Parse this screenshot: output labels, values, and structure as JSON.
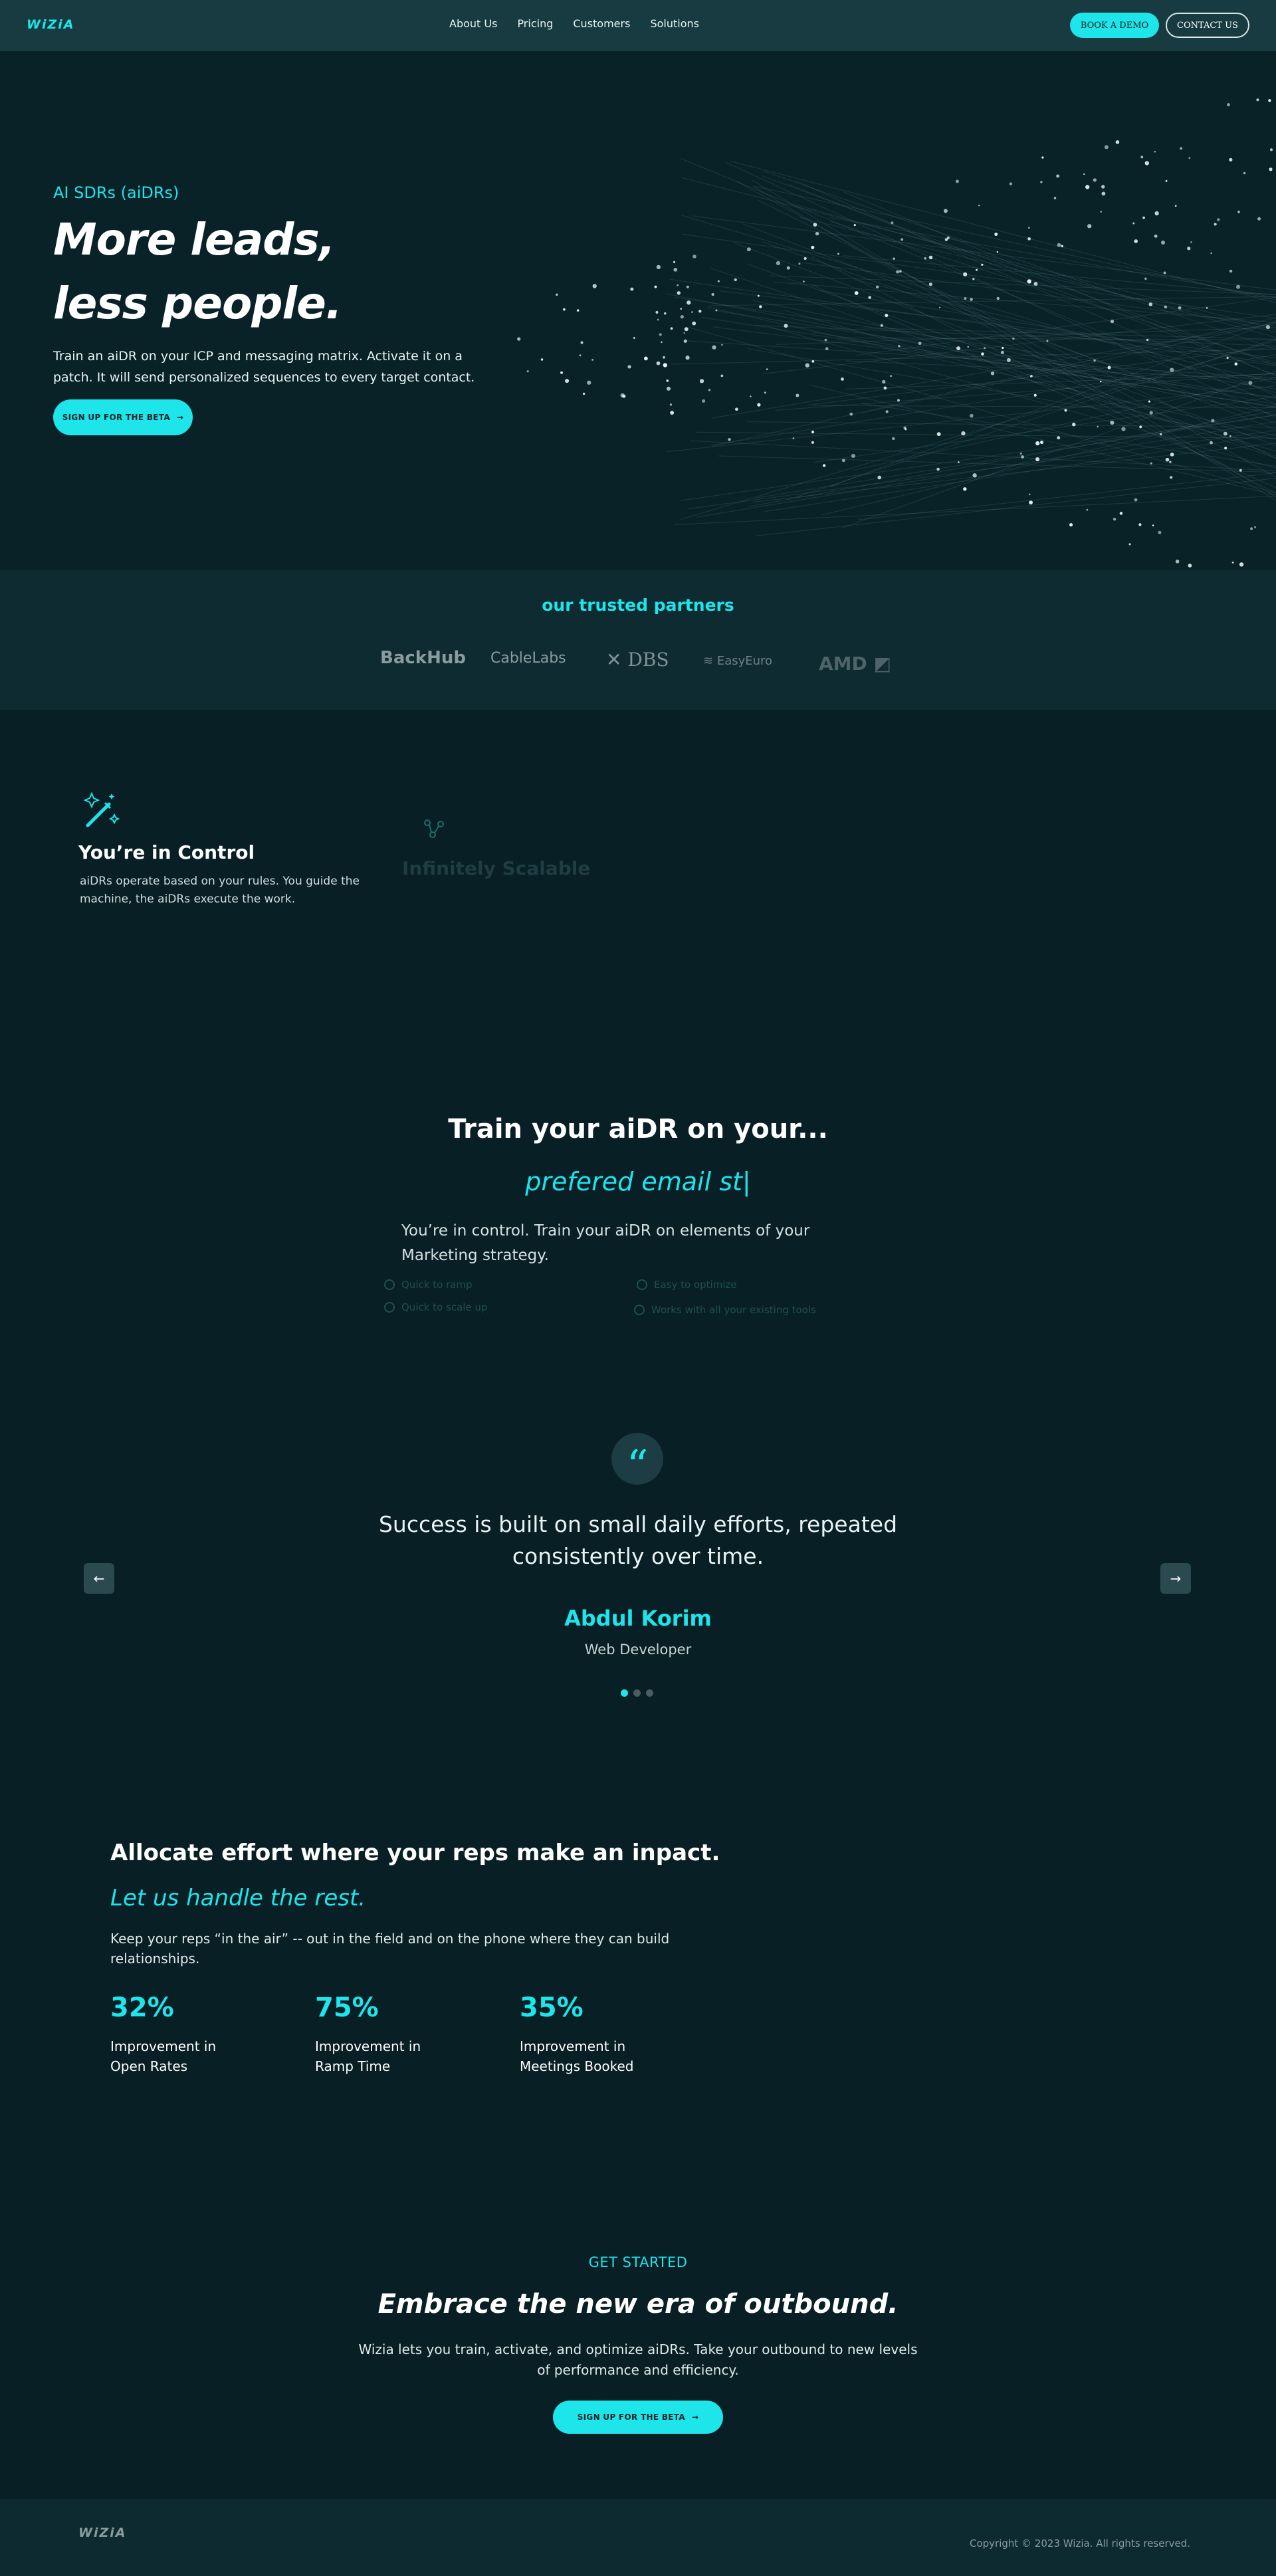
{
  "nav": {
    "logo": "WiZiA",
    "links": [
      "About Us",
      "Pricing",
      "Customers",
      "Solutions"
    ],
    "book_demo": "BOOK A DEMO",
    "contact": "CONTACT US"
  },
  "hero": {
    "eyebrow": "AI SDRs (aiDRs)",
    "title_line1": "More leads,",
    "title_line2": "less people.",
    "description": "Train an aiDR on your ICP and messaging matrix. Activate it on a patch. It will send personalized sequences to every target contact.",
    "cta": "SIGN UP FOR THE BETA"
  },
  "partners": {
    "title": "our trusted partners",
    "logos": [
      "BackHub",
      "CableLabs",
      "DBS",
      "EasyEuro",
      "AMD"
    ]
  },
  "features": [
    {
      "icon": "magic-wand-icon",
      "title": "You’re in Control",
      "description": "aiDRs operate based on your rules. You guide the machine, the aiDRs execute the work."
    },
    {
      "icon": "network-icon",
      "title": "Infinitely Scalable"
    }
  ],
  "train": {
    "title": "Train your aiDR on your...",
    "typing": "prefered email st|",
    "description": "You’re in control. Train your aiDR on elements of your Marketing strategy.",
    "checks": [
      "Quick to ramp",
      "Easy to optimize",
      "Quick to scale up",
      "Works with all your existing tools"
    ]
  },
  "testimonial": {
    "quote": "Success is built on small daily efforts, repeated consistently over time.",
    "name": "Abdul Korim",
    "role": "Web Developer"
  },
  "effort": {
    "title": "Allocate effort where your reps make an inpact.",
    "subtitle": "Let us handle the rest.",
    "description": "Keep your reps “in the air” -- out in the field and on the phone where they can build relationships.",
    "stats": [
      {
        "value": "32%",
        "label_line1": "Improvement in",
        "label_line2": "Open Rates"
      },
      {
        "value": "75%",
        "label_line1": "Improvement in",
        "label_line2": "Ramp Time"
      },
      {
        "value": "35%",
        "label_line1": "Improvement in",
        "label_line2": "Meetings Booked"
      }
    ]
  },
  "get_started": {
    "eyebrow": "GET STARTED",
    "title": "Embrace the new era of outbound.",
    "description_line1": "Wizia lets you train, activate, and optimize aiDRs. Take your outbound to new levels",
    "description_line2": "of performance and efficiency.",
    "cta": "SIGN UP FOR THE BETA"
  },
  "footer": {
    "logo": "WiZiA",
    "copyright": "Copyright © 2023 Wizia. All rights reserved."
  },
  "colors": {
    "accent": "#1de5ea",
    "background": "#071f25",
    "nav": "#183b41"
  }
}
